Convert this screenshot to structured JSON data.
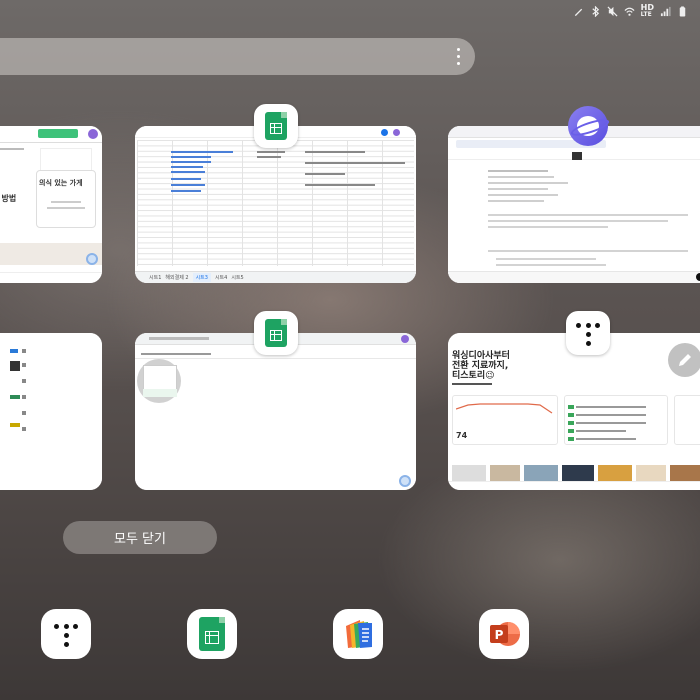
{
  "status_bar": {
    "network": "HD",
    "network_sub": "LTE",
    "icons": [
      "pen-icon",
      "bluetooth-icon",
      "mute-icon",
      "wifi-icon",
      "signal-icon",
      "battery-icon"
    ]
  },
  "search": {
    "menu_icon": "more-vertical-icon"
  },
  "cards": {
    "sheets_top": {
      "app_icon": "google-sheets-icon",
      "tabs": [
        "시트1",
        "해외결제 2",
        "시트3",
        "시트4",
        "시트5"
      ]
    },
    "internet_top": {
      "app_icon": "samsung-internet-icon"
    },
    "sheets_bottom": {
      "app_icon": "google-sheets-icon"
    },
    "tmap_bottom": {
      "app_icon": "tmap-icon",
      "headline_1": "워싱디아사부터",
      "headline_2": "전환 지료까지,",
      "headline_3": "티스토리😉",
      "stat_value": "74"
    },
    "left_top": {
      "title_1": "의식 있는 가게",
      "title_2": "하는 방법"
    }
  },
  "close_all_label": "모두 닫기",
  "dock": [
    {
      "name": "tmap",
      "icon": "tmap-icon"
    },
    {
      "name": "google-sheets",
      "icon": "google-sheets-icon"
    },
    {
      "name": "polaris-office",
      "icon": "polaris-office-icon"
    },
    {
      "name": "powerpoint",
      "icon": "powerpoint-icon"
    }
  ],
  "colors": {
    "sheets_green": "#1ea362",
    "internet_purple": "#6a5fe8",
    "powerpoint_red": "#c43e1c"
  }
}
